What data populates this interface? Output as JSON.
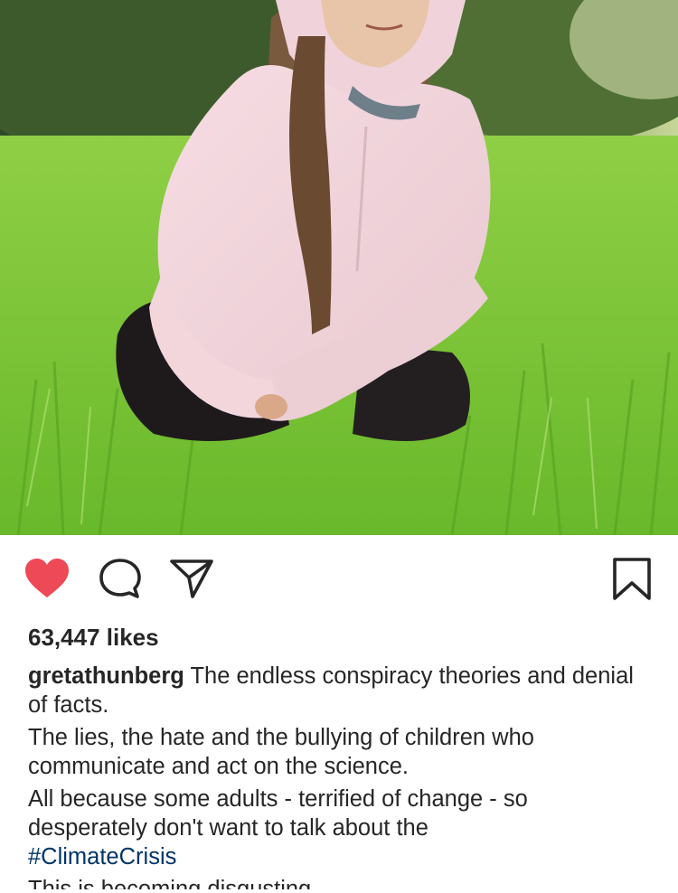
{
  "post": {
    "photo_alt": "",
    "likes": "63,447 likes",
    "username": "gretathunberg",
    "caption_lines": [
      "The endless conspiracy theories and denial of facts.",
      "The lies, the hate and the bullying of children who communicate and act on the science.",
      "All because some adults - terrified of change - so desperately don't want to talk about the"
    ],
    "hashtag": "#ClimateCrisis",
    "cutoff_line": "This is becoming disgusting."
  },
  "actions": {
    "like_icon": "heart-filled-icon",
    "comment_icon": "speech-bubble-icon",
    "share_icon": "paper-plane-icon",
    "save_icon": "bookmark-icon"
  },
  "colors": {
    "like_red": "#ed4956",
    "text": "#262626",
    "hashtag": "#003569"
  }
}
